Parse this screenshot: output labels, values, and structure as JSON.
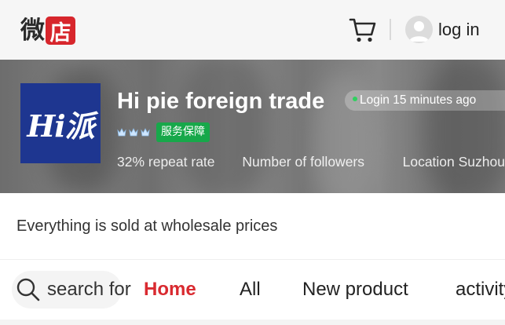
{
  "header": {
    "logo": {
      "char1": "微",
      "char2": "店"
    },
    "cart_icon": "cart-icon",
    "avatar_icon": "user-avatar-icon",
    "login_label": "log in"
  },
  "store": {
    "logo_text": "Hi派",
    "name": "Hi pie foreign trade",
    "login_status": "Login 15 minutes ago",
    "crown_icons": [
      "crown-icon",
      "crown-icon",
      "crown-icon"
    ],
    "service_badge": "服务保障",
    "stats": {
      "repeat_rate": "32% repeat rate",
      "followers": "Number of followers",
      "location": "Location Suzhou"
    },
    "slogan": "Everything is sold at wholesale prices"
  },
  "nav": {
    "search_label": "search for",
    "tabs": [
      "Home",
      "All",
      "New product",
      "activity"
    ],
    "active_tab": "Home"
  },
  "colors": {
    "brand_red": "#d92a30",
    "store_logo_blue": "#1e3690",
    "service_green": "#17a84a",
    "online_dot": "#2fd05f"
  }
}
